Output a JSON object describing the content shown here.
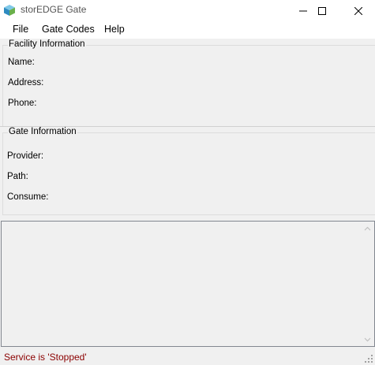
{
  "window": {
    "title": "storEDGE Gate",
    "icon": "storedge-cube-icon",
    "controls": [
      "minimize-icon",
      "maximize-icon",
      "close-icon"
    ]
  },
  "menu": {
    "items": [
      {
        "label": "File"
      },
      {
        "label": "Gate Codes"
      },
      {
        "label": "Help"
      }
    ]
  },
  "facility": {
    "legend": "Facility Information",
    "name_label": "Name:",
    "address_label": "Address:",
    "phone_label": "Phone:"
  },
  "gate": {
    "legend": "Gate Information",
    "provider_label": "Provider:",
    "path_label": "Path:",
    "consume_label": "Consume:"
  },
  "status": {
    "text": "Service is 'Stopped'",
    "color": "#8b0000"
  },
  "colors": {
    "titlebar_bg": "#ffffff",
    "window_bg": "#f0f0f0"
  }
}
